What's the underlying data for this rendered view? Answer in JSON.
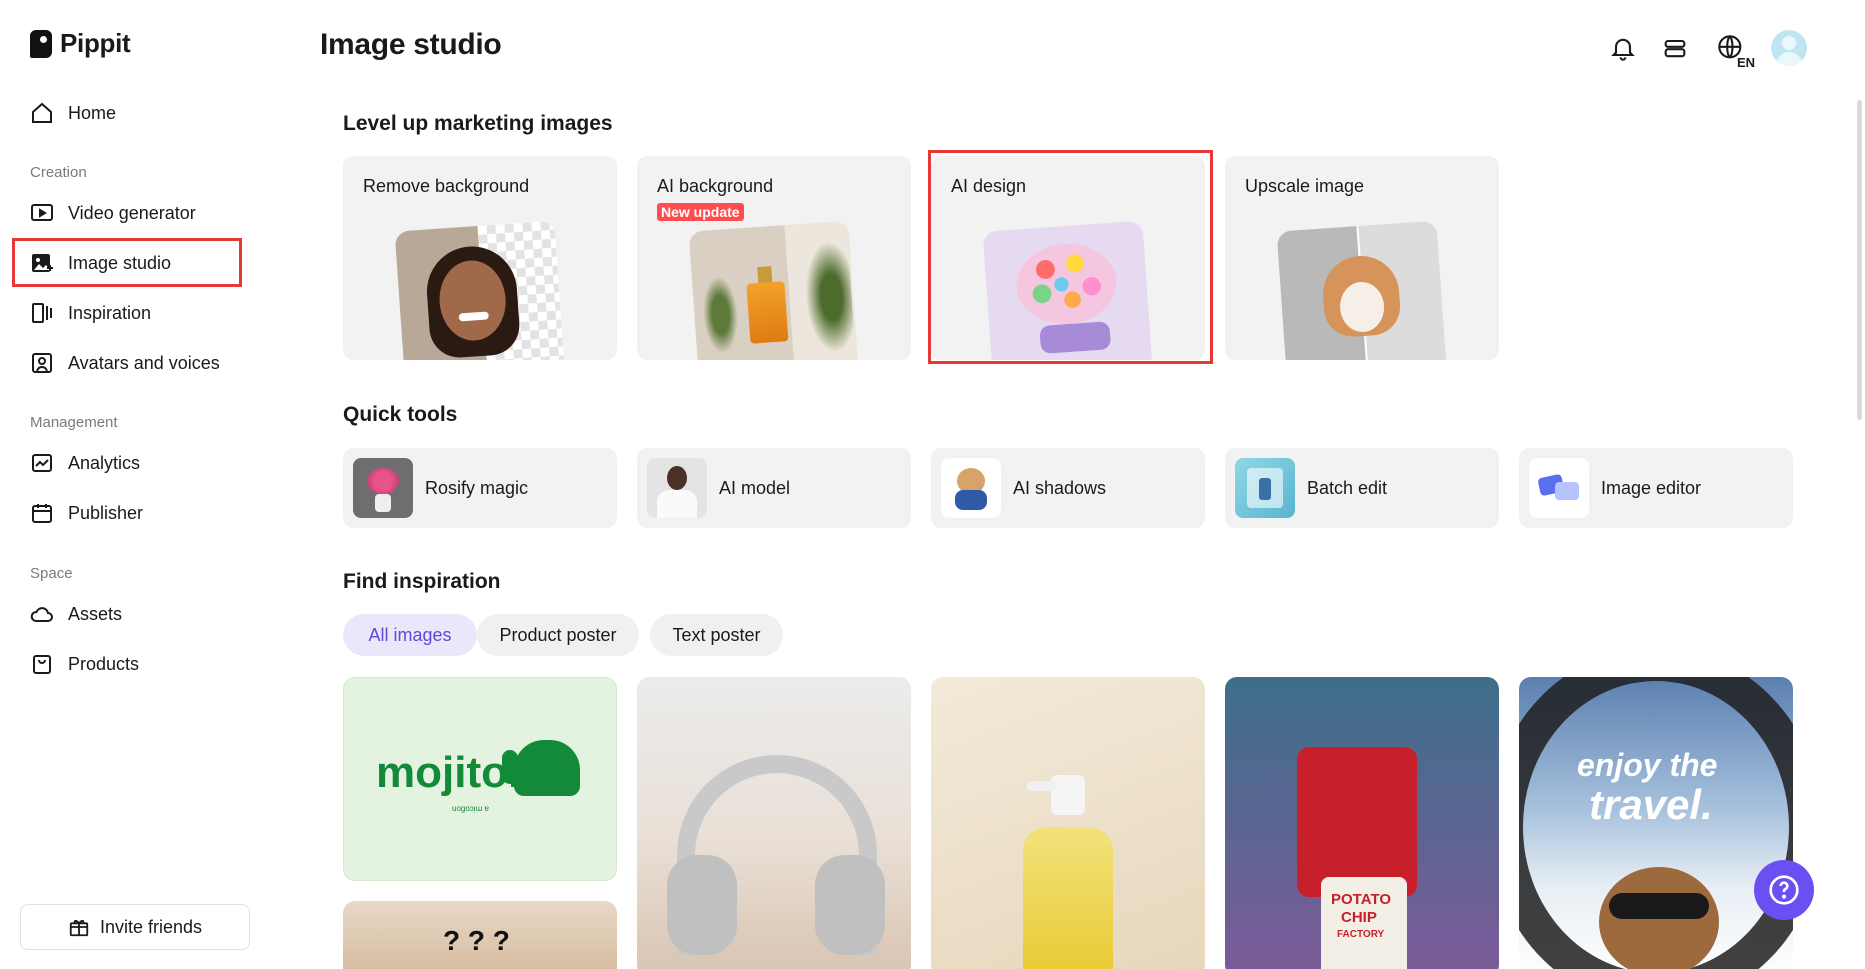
{
  "app": {
    "name": "Pippit"
  },
  "sidebar": {
    "home": "Home",
    "sections": {
      "creation": "Creation",
      "management": "Management",
      "space": "Space"
    },
    "items": {
      "video_generator": "Video generator",
      "image_studio": "Image studio",
      "inspiration": "Inspiration",
      "avatars_voices": "Avatars and voices",
      "analytics": "Analytics",
      "publisher": "Publisher",
      "assets": "Assets",
      "products": "Products"
    },
    "invite": "Invite friends",
    "active_item": "Image studio"
  },
  "header": {
    "title": "Image studio",
    "language": "EN"
  },
  "marketing": {
    "title": "Level up marketing images",
    "cards": [
      {
        "label": "Remove background"
      },
      {
        "label": "AI background",
        "badge": "New update"
      },
      {
        "label": "AI design"
      },
      {
        "label": "Upscale image"
      }
    ]
  },
  "quick_tools": {
    "title": "Quick tools",
    "items": [
      {
        "label": "Rosify magic"
      },
      {
        "label": "AI model"
      },
      {
        "label": "AI shadows"
      },
      {
        "label": "Batch edit"
      },
      {
        "label": "Image editor"
      }
    ]
  },
  "inspiration": {
    "title": "Find inspiration",
    "filters": [
      "All images",
      "Product poster",
      "Text poster"
    ],
    "active_filter": "All images",
    "gallery": {
      "mojito_text": "mojito.",
      "mojito_sub": "uogoɔᴉɯ ɐ",
      "potato_text_1": "POTATO",
      "potato_text_2": "CHIP",
      "potato_text_3": "FACTORY",
      "travel_text_1": "enjoy the",
      "travel_text_2": "travel.",
      "cat_marks": "? ? ?"
    }
  },
  "colors": {
    "accent": "#6a4ff2",
    "highlight": "#e53935",
    "badge": "#ff4d4f",
    "chip_active": "#5b4bd8"
  }
}
